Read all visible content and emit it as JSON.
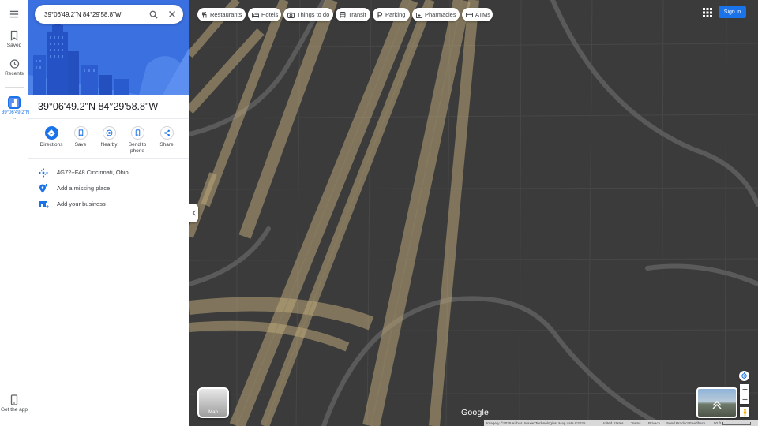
{
  "rail": {
    "saved_label": "Saved",
    "recents_label": "Recents",
    "place_label": "39°06'49.2\"N ...",
    "get_app_label": "Get the app"
  },
  "search": {
    "value": "39°06'49.2\"N 84°29'58.8\"W"
  },
  "place": {
    "title": "39°06'49.2\"N 84°29'58.8\"W",
    "actions": {
      "directions": "Directions",
      "save": "Save",
      "nearby": "Nearby",
      "send_to_phone": "Send to phone",
      "share": "Share"
    },
    "plus_code": "4G72+F48 Cincinnati, Ohio",
    "add_missing_place": "Add a missing place",
    "add_business": "Add your business"
  },
  "chips": {
    "restaurants": "Restaurants",
    "hotels": "Hotels",
    "things_to_do": "Things to do",
    "transit": "Transit",
    "parking": "Parking",
    "pharmacies": "Pharmacies",
    "atms": "ATMs"
  },
  "header": {
    "sign_in": "Sign in"
  },
  "map": {
    "layer_label": "Map",
    "brand": "Google",
    "footer": {
      "imagery": "Imagery ©2025 Airbus, Maxar Technologies, Map data ©2025",
      "region": "United States",
      "terms": "Terms",
      "privacy": "Privacy",
      "feedback": "Send Product Feedback",
      "scale": "50 ft"
    }
  },
  "colors": {
    "accent": "#1a73e8",
    "map_background": "#3b3b3b",
    "road_fill": "#b9a678"
  }
}
